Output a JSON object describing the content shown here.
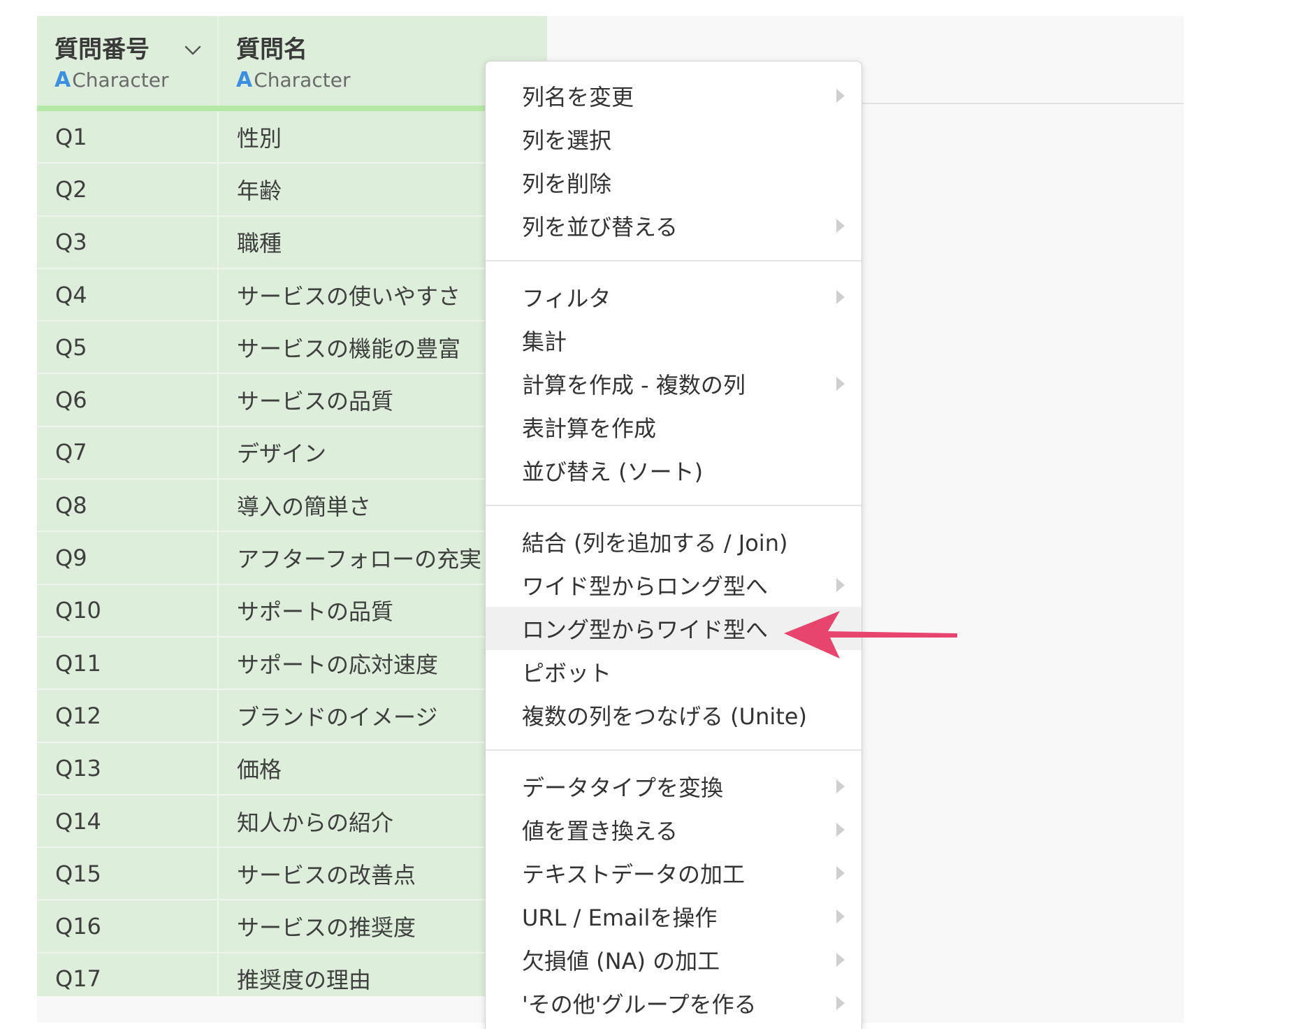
{
  "columns": [
    {
      "name": "質問番号",
      "type_glyph": "A",
      "type_label": "Character"
    },
    {
      "name": "質問名",
      "type_glyph": "A",
      "type_label": "Character"
    }
  ],
  "rows": [
    {
      "id": "Q1",
      "name": "性別"
    },
    {
      "id": "Q2",
      "name": "年齢"
    },
    {
      "id": "Q3",
      "name": "職種"
    },
    {
      "id": "Q4",
      "name": "サービスの使いやすさ"
    },
    {
      "id": "Q5",
      "name": "サービスの機能の豊富"
    },
    {
      "id": "Q6",
      "name": "サービスの品質"
    },
    {
      "id": "Q7",
      "name": "デザイン"
    },
    {
      "id": "Q8",
      "name": "導入の簡単さ"
    },
    {
      "id": "Q9",
      "name": "アフターフォローの充実"
    },
    {
      "id": "Q10",
      "name": "サポートの品質"
    },
    {
      "id": "Q11",
      "name": "サポートの応対速度"
    },
    {
      "id": "Q12",
      "name": "ブランドのイメージ"
    },
    {
      "id": "Q13",
      "name": "価格"
    },
    {
      "id": "Q14",
      "name": "知人からの紹介"
    },
    {
      "id": "Q15",
      "name": "サービスの改善点"
    },
    {
      "id": "Q16",
      "name": "サービスの推奨度"
    },
    {
      "id": "Q17",
      "name": "推奨度の理由"
    }
  ],
  "menu": {
    "groups": [
      [
        {
          "label": "列名を変更",
          "submenu": true
        },
        {
          "label": "列を選択",
          "submenu": false
        },
        {
          "label": "列を削除",
          "submenu": false
        },
        {
          "label": "列を並び替える",
          "submenu": true
        }
      ],
      [
        {
          "label": "フィルタ",
          "submenu": true
        },
        {
          "label": "集計",
          "submenu": false
        },
        {
          "label": "計算を作成 - 複数の列",
          "submenu": true
        },
        {
          "label": "表計算を作成",
          "submenu": false
        },
        {
          "label": "並び替え (ソート)",
          "submenu": false
        }
      ],
      [
        {
          "label": "結合 (列を追加する / Join)",
          "submenu": false
        },
        {
          "label": "ワイド型からロング型へ",
          "submenu": true
        },
        {
          "label": "ロング型からワイド型へ",
          "submenu": false,
          "highlighted": true
        },
        {
          "label": "ピボット",
          "submenu": false
        },
        {
          "label": "複数の列をつなげる (Unite)",
          "submenu": false
        }
      ],
      [
        {
          "label": "データタイプを変換",
          "submenu": true
        },
        {
          "label": "値を置き換える",
          "submenu": true
        },
        {
          "label": "テキストデータの加工",
          "submenu": true
        },
        {
          "label": "URL / Emailを操作",
          "submenu": true
        },
        {
          "label": "欠損値 (NA) の加工",
          "submenu": true
        },
        {
          "label": "'その他'グループを作る",
          "submenu": true
        }
      ]
    ]
  },
  "colors": {
    "table_bg": "#ddeeda",
    "header_bar": "#b5e8a6",
    "type_glyph": "#3b8fe0",
    "arrow": "#e8456e",
    "menu_highlight": "#f0f0f0"
  },
  "icons": {
    "column_menu": "chevron-down-icon",
    "submenu": "triangle-right-icon",
    "callout": "arrow-left-icon"
  }
}
